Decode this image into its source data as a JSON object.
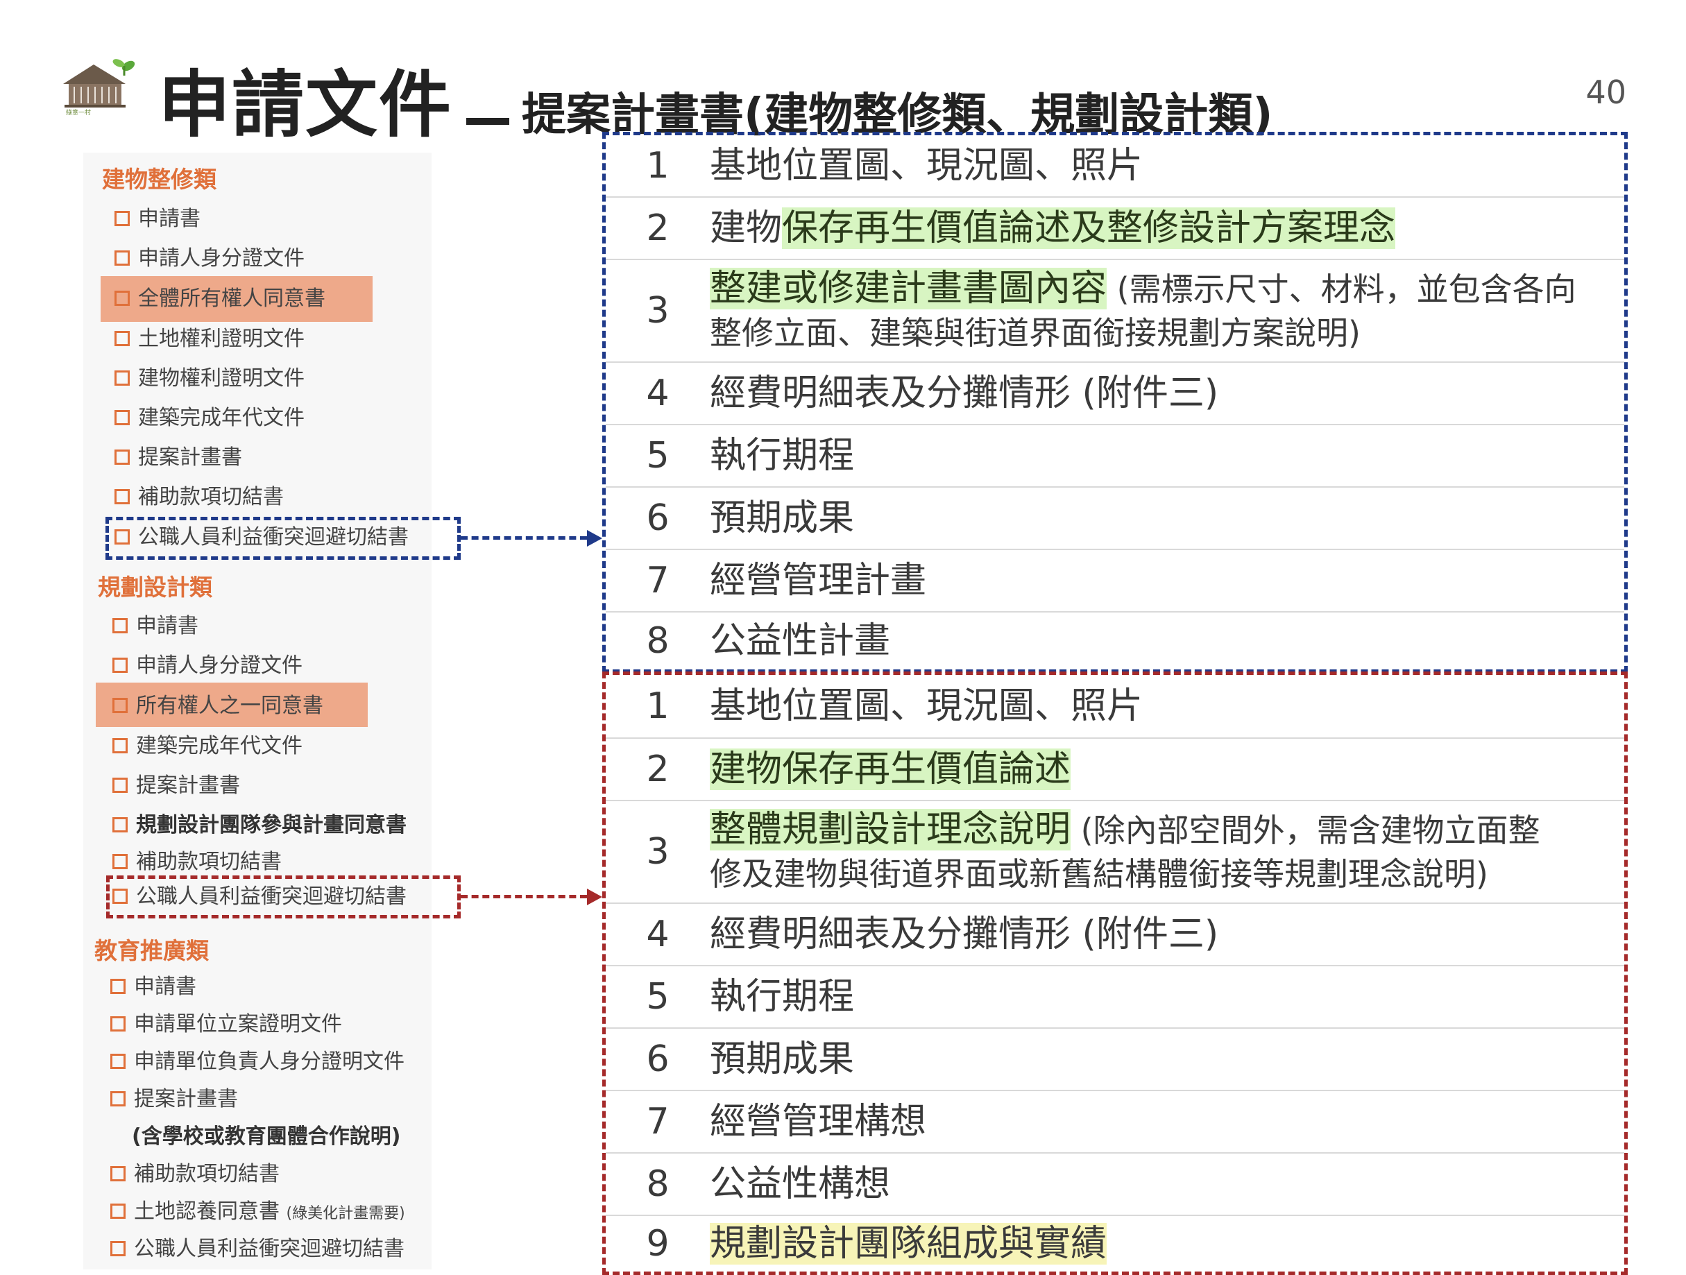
{
  "header": {
    "title_main": "申請文件",
    "title_sub": "提案計畫書(建物整修類、規劃設計類)",
    "page_number": "40",
    "logo_caption": "綠意一村"
  },
  "checklist": {
    "building": {
      "heading": "建物整修類",
      "items": [
        "申請書",
        "申請人身分證文件",
        "全體所有權人同意書",
        "土地權利證明文件",
        "建物權利證明文件",
        "建築完成年代文件",
        "提案計畫書",
        "補助款項切結書",
        "公職人員利益衝突迴避切結書"
      ]
    },
    "planning": {
      "heading": "規劃設計類",
      "items": [
        "申請書",
        "申請人身分證文件",
        "所有權人之一同意書",
        "建築完成年代文件",
        "提案計畫書",
        "規劃設計團隊參與計畫同意書",
        "補助款項切結書",
        "公職人員利益衝突迴避切結書"
      ]
    },
    "education": {
      "heading": "教育推廣類",
      "items": [
        "申請書",
        "申請單位立案證明文件",
        "申請單位負責人身分證明文件",
        "提案計畫書",
        "(含學校或教育團體合作說明)",
        "補助款項切結書",
        "土地認養同意書",
        "公職人員利益衝突迴避切結書"
      ],
      "item7_note": "(綠美化計畫需要)"
    }
  },
  "table_building": {
    "rows": [
      {
        "num": "1",
        "text": "基地位置圖、現況圖、照片"
      },
      {
        "num": "2",
        "prefix": "建物",
        "highlight": "保存再生價值論述及整修設計方案理念"
      },
      {
        "num": "3",
        "highlight": "整建或修建計畫書圖內容",
        "note_line1": " (需標示尺寸、材料，並包含各向",
        "note_line2": "整修立面、建築與街道界面銜接規劃方案說明)"
      },
      {
        "num": "4",
        "text": "經費明細表及分攤情形 (附件三)"
      },
      {
        "num": "5",
        "text": "執行期程"
      },
      {
        "num": "6",
        "text": "預期成果"
      },
      {
        "num": "7",
        "text": "經營管理計畫"
      },
      {
        "num": "8",
        "text": "公益性計畫"
      }
    ]
  },
  "table_planning": {
    "rows": [
      {
        "num": "1",
        "text": "基地位置圖、現況圖、照片"
      },
      {
        "num": "2",
        "highlight": "建物保存再生價值論述"
      },
      {
        "num": "3",
        "highlight": "整體規劃設計理念說明",
        "note_line1": " (除內部空間外，需含建物立面整",
        "note_line2": "修及建物與街道界面或新舊結構體銜接等規劃理念說明)"
      },
      {
        "num": "4",
        "text": "經費明細表及分攤情形 (附件三)"
      },
      {
        "num": "5",
        "text": "執行期程"
      },
      {
        "num": "6",
        "text": "預期成果"
      },
      {
        "num": "7",
        "text": "經營管理構想"
      },
      {
        "num": "8",
        "text": "公益性構想"
      },
      {
        "num": "9",
        "highlight_yellow": "規劃設計團隊組成與實績"
      }
    ]
  },
  "colors": {
    "accent_orange": "#e0703a",
    "highlight_salmon": "#eea98a",
    "dash_blue": "#1f3a8a",
    "dash_red": "#a52a2a",
    "highlight_green": "#d8f5c2",
    "highlight_yellow": "#f7f4b8"
  }
}
